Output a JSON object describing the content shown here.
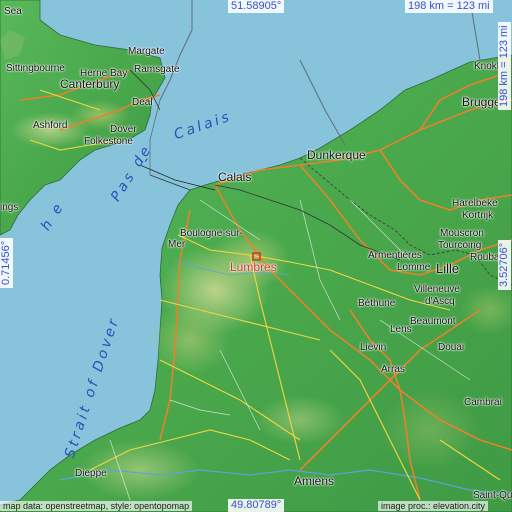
{
  "map": {
    "highlight_city": "Lumbres",
    "highlight_color": "#d83030",
    "sea_color": "#87c4dc",
    "land_color": "#4caf50",
    "coords": {
      "north": "51.58905°",
      "south": "49.80789°",
      "west": "0.71456°",
      "east": "3.52706°"
    },
    "scale_top": "198 km = 123 mi",
    "scale_right": "198 km = 123 mi",
    "attribution_left": "map data: openstreetmap, style: opentopomap",
    "attribution_right": "image proc.: elevation.city",
    "sea_labels": {
      "calais": "Calais",
      "pas_de": "Pas de",
      "he_e": "h e",
      "strait": "Strait of Dover",
      "dash": "-"
    },
    "cities": {
      "sea": "Sea",
      "margate": "Margate",
      "sittingbourne": "Sittingbourne",
      "herne_bay": "Herne Bay",
      "ramsgate": "Ramsgate",
      "canterbury": "Canterbury",
      "deal": "Deal",
      "ashford": "Ashford",
      "dover": "Dover",
      "folkestone": "Folkestone",
      "ings": "ings",
      "calais": "Calais",
      "dunkerque": "Dunkerque",
      "brugge": "Brugge",
      "knokke": "Knokk",
      "harelbeke": "Harelbeke",
      "kortrijk": "Kortrijk",
      "mouscron": "Mouscron",
      "tourcoing": "Tourcoing",
      "roubaix": "Roubaix",
      "boulogne1": "Boulogne-sur-",
      "boulogne2": "Mer",
      "armentieres": "Armentières",
      "lomme": "Lomme",
      "lille": "Lille",
      "villeneuve1": "Villeneuve",
      "villeneuve2": "d'Ascq",
      "bethune": "Béthune",
      "lens": "Lens",
      "beaumont": "Beaumont",
      "lievin": "Liévin",
      "douai": "Douai",
      "arras": "Arras",
      "cambrai": "Cambrai",
      "dieppe": "Dieppe",
      "amiens": "Amiens",
      "saint_quentin": "Saint-Qu"
    }
  }
}
